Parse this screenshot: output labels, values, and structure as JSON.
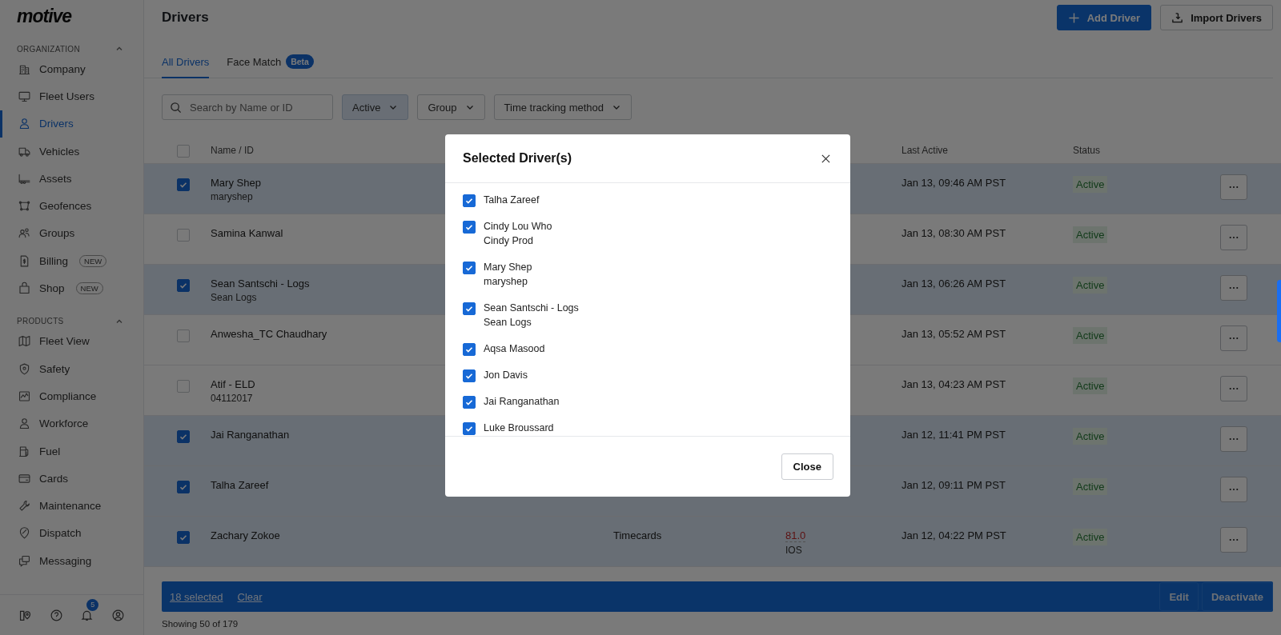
{
  "logo": "motive",
  "sidebar": {
    "sections": [
      {
        "title": "ORGANIZATION",
        "expanded": true,
        "items": [
          {
            "label": "Company",
            "selected": false
          },
          {
            "label": "Fleet Users",
            "selected": false
          },
          {
            "label": "Drivers",
            "selected": true
          },
          {
            "label": "Vehicles",
            "selected": false
          },
          {
            "label": "Assets",
            "selected": false
          },
          {
            "label": "Geofences",
            "selected": false
          },
          {
            "label": "Groups",
            "selected": false
          },
          {
            "label": "Billing",
            "selected": false,
            "badge": "NEW"
          },
          {
            "label": "Shop",
            "selected": false,
            "badge": "NEW"
          }
        ]
      },
      {
        "title": "PRODUCTS",
        "expanded": true,
        "items": [
          {
            "label": "Fleet View",
            "selected": false
          },
          {
            "label": "Safety",
            "selected": false
          },
          {
            "label": "Compliance",
            "selected": false
          },
          {
            "label": "Workforce",
            "selected": false
          },
          {
            "label": "Fuel",
            "selected": false
          },
          {
            "label": "Cards",
            "selected": false
          },
          {
            "label": "Maintenance",
            "selected": false
          },
          {
            "label": "Dispatch",
            "selected": false
          },
          {
            "label": "Messaging",
            "selected": false
          }
        ]
      }
    ],
    "notification_count": "5"
  },
  "page": {
    "title": "Drivers",
    "buttons": [
      {
        "kind": "primary",
        "label": "Add Driver"
      },
      {
        "kind": "secondary",
        "label": "Import Drivers"
      }
    ]
  },
  "tabs": [
    {
      "label": "All Drivers",
      "selected": true
    },
    {
      "label": "Face Match",
      "selected": false,
      "badge": "Beta"
    }
  ],
  "search": {
    "placeholder": "Search by Name or ID"
  },
  "filters": [
    {
      "label": "Active",
      "selected": true
    },
    {
      "label": "Group",
      "selected": false
    },
    {
      "label": "Time tracking method",
      "selected": false
    }
  ],
  "table": {
    "header_checked": false,
    "columns": [
      "Name / ID",
      "Last Active",
      "Status"
    ],
    "rows": [
      {
        "checked": true,
        "name": "Mary Shep",
        "id": "maryshep",
        "last_active": "Jan 13, 09:46 AM PST",
        "status": "Active"
      },
      {
        "checked": false,
        "name": "Samina Kanwal",
        "last_active": "Jan 13, 08:30 AM PST",
        "status": "Active"
      },
      {
        "checked": true,
        "name": "Sean Santschi - Logs",
        "id": "Sean Logs",
        "last_active": "Jan 13, 06:26 AM PST",
        "status": "Active"
      },
      {
        "checked": false,
        "name": "Anwesha_TC Chaudhary",
        "last_active": "Jan 13, 05:52 AM PST",
        "status": "Active"
      },
      {
        "checked": false,
        "name": "Atif - ELD",
        "id": "04112017",
        "last_active": "Jan 13, 04:23 AM PST",
        "status": "Active"
      },
      {
        "checked": true,
        "name": "Jai Ranganathan",
        "last_active": "Jan 12, 11:41 PM PST",
        "status": "Active"
      },
      {
        "checked": true,
        "name": "Talha Zareef",
        "last_active": "Jan 12, 09:11 PM PST",
        "status": "Active"
      },
      {
        "checked": true,
        "name": "Zachary Zokoe",
        "time_tracking": "Timecards",
        "score": "81.0",
        "device": "IOS",
        "last_active": "Jan 12, 04:22 PM PST",
        "status": "Active"
      }
    ]
  },
  "selection_bar": {
    "count": "18 selected",
    "clear": "Clear",
    "buttons": [
      "Edit",
      "Deactivate"
    ]
  },
  "footer": "Showing 50 of 179",
  "modal": {
    "title": "Selected Driver(s)",
    "items": [
      {
        "checked": true,
        "name": "Talha Zareef"
      },
      {
        "checked": true,
        "name": "Cindy Lou Who",
        "id": "Cindy Prod"
      },
      {
        "checked": true,
        "name": "Mary Shep",
        "id": "maryshep"
      },
      {
        "checked": true,
        "name": "Sean Santschi - Logs",
        "id": "Sean Logs"
      },
      {
        "checked": true,
        "name": "Aqsa Masood"
      },
      {
        "checked": true,
        "name": "Jon Davis"
      },
      {
        "checked": true,
        "name": "Jai Ranganathan"
      },
      {
        "checked": true,
        "name": "Luke Broussard"
      }
    ],
    "button": "Close"
  }
}
